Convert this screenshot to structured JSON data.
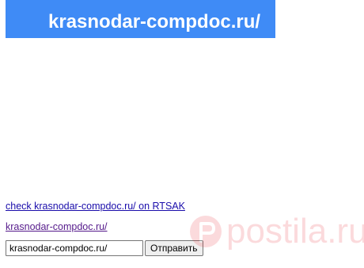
{
  "banner": {
    "title": "krasnodar-compdoc.ru/",
    "background_color": "#3f8bf6",
    "text_color": "#ffffff"
  },
  "links": {
    "check_label": "check krasnodar-compdoc.ru/ on RTSAK",
    "domain_label": "krasnodar-compdoc.ru/"
  },
  "form": {
    "url_value": "krasnodar-compdoc.ru/",
    "submit_label": "Отправить"
  },
  "watermark": {
    "text": "postila.ru",
    "icon": "postila-logo-icon",
    "color": "#e8202b"
  }
}
